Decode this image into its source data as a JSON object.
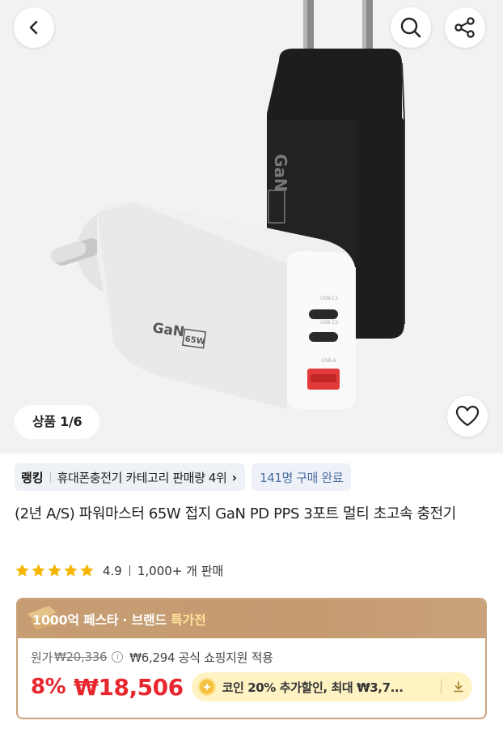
{
  "hero": {
    "image_counter": "상품 1/6",
    "product_label": "GaN",
    "product_badge": "65W",
    "icons": {
      "back": "chevron-left-icon",
      "search": "search-icon",
      "share": "share-icon",
      "like": "heart-icon"
    }
  },
  "ranking": {
    "tag": "랭킹",
    "text": "휴대폰충전기 카테고리 판매량 4위",
    "chevron": "›",
    "purchase_count": "141명 구매 완료"
  },
  "product": {
    "title": "(2년 A/S) 파워마스터 65W 접지 GaN PD PPS 3포트 멀티 초고속 충전기"
  },
  "rating": {
    "stars": 5,
    "score": "4.9",
    "sales": "1,000+ 개 판매",
    "star_color": "#f7b500"
  },
  "promo": {
    "title_prefix": "1000억 페스타 · 브랜드 ",
    "title_accent": "특가전",
    "original_label": "원가",
    "original_price": "₩20,336",
    "support_text": "₩6,294 공식 쇼핑지원 적용",
    "discount": "8%",
    "final_price": "₩18,506",
    "coupon_text": "코인 20% 추가할인, 최대 ₩3,7...",
    "accent_color": "#e8262e"
  }
}
